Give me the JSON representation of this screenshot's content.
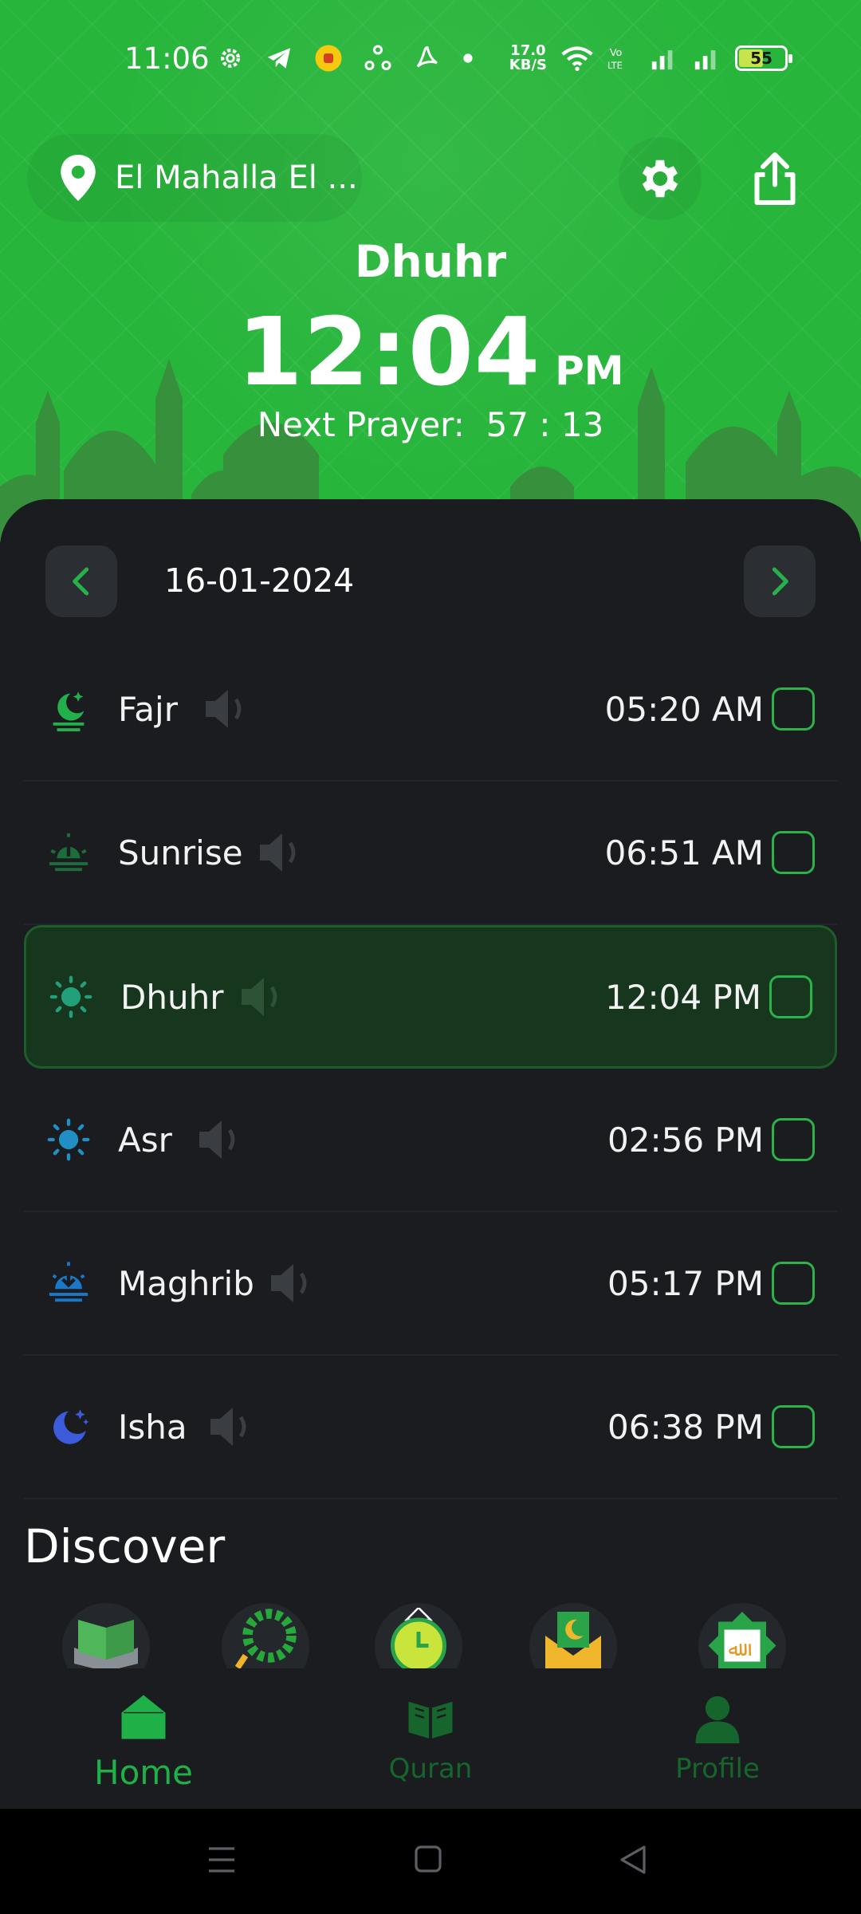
{
  "status_bar": {
    "time": "11:06",
    "net_speed_value": "17.0",
    "net_speed_unit": "KB/S",
    "battery": "55"
  },
  "header": {
    "location": "El Mahalla El ...",
    "current_prayer": "Dhuhr",
    "current_time": "12:04",
    "current_ampm": "PM",
    "next_prayer_label": "Next Prayer:",
    "next_prayer_countdown": "57 : 13"
  },
  "date": "16-01-2024",
  "prayers": [
    {
      "name": "Fajr",
      "time": "05:20 AM",
      "icon": "fajr-icon",
      "checked": false
    },
    {
      "name": "Sunrise",
      "time": "06:51 AM",
      "icon": "sunrise-icon",
      "checked": false
    },
    {
      "name": "Dhuhr",
      "time": "12:04 PM",
      "icon": "dhuhr-icon",
      "checked": false,
      "active": true
    },
    {
      "name": "Asr",
      "time": "02:56 PM",
      "icon": "asr-icon",
      "checked": false
    },
    {
      "name": "Maghrib",
      "time": "05:17 PM",
      "icon": "maghrib-icon",
      "checked": false
    },
    {
      "name": "Isha",
      "time": "06:38 PM",
      "icon": "isha-icon",
      "checked": false
    }
  ],
  "discover": {
    "title": "Discover",
    "items": [
      "quran-book-icon",
      "tasbih-beads-icon",
      "clock-icon",
      "mosque-envelope-icon",
      "allah-emblem-icon"
    ]
  },
  "bottom_nav": {
    "home": "Home",
    "quran": "Quran",
    "profile": "Profile"
  },
  "colors": {
    "header_green": "#27b53b",
    "accent_green": "#1fb147",
    "background": "#1a1c1f",
    "active_row": "#16361e"
  }
}
